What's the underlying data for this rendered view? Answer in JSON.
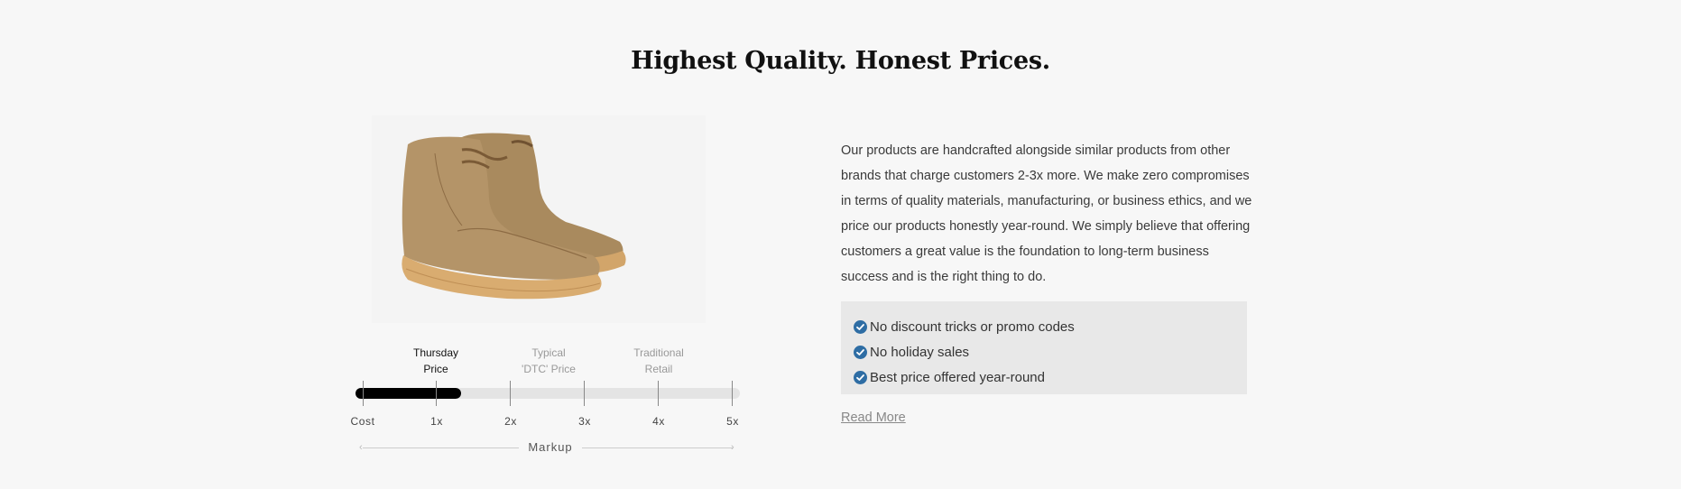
{
  "section": {
    "title": "Highest Quality. Honest Prices."
  },
  "product": {
    "image_alt": "Tan suede chukka boots with crepe sole",
    "icon": "boot-image"
  },
  "markup_scale": {
    "labels_top": [
      {
        "line1": "Thursday",
        "line2": "Price",
        "active": true
      },
      {
        "line1": "Typical",
        "line2": "'DTC' Price",
        "active": false
      },
      {
        "line1": "Traditional",
        "line2": "Retail",
        "active": false
      }
    ],
    "ticks": [
      "Cost",
      "1x",
      "2x",
      "3x",
      "4x",
      "5x"
    ],
    "fill_fraction": 0.275,
    "axis_title": "Markup",
    "fill_color": "#000000",
    "track_color": "#e4e4e4"
  },
  "description": "Our products are handcrafted alongside similar products from other brands that charge customers 2-3x more. We make zero compromises in terms of quality materials, manufacturing, or business ethics, and we price our products honestly year-round. We simply believe that offering customers a great value is the foundation to long-term business success and is the right thing to do.",
  "features": [
    {
      "icon": "check-circle-icon",
      "text": "No discount tricks or promo codes"
    },
    {
      "icon": "check-circle-icon",
      "text": "No holiday sales"
    },
    {
      "icon": "check-circle-icon",
      "text": "Best price offered year-round"
    }
  ],
  "check_color": "#2e6da4",
  "read_more": "Read More"
}
